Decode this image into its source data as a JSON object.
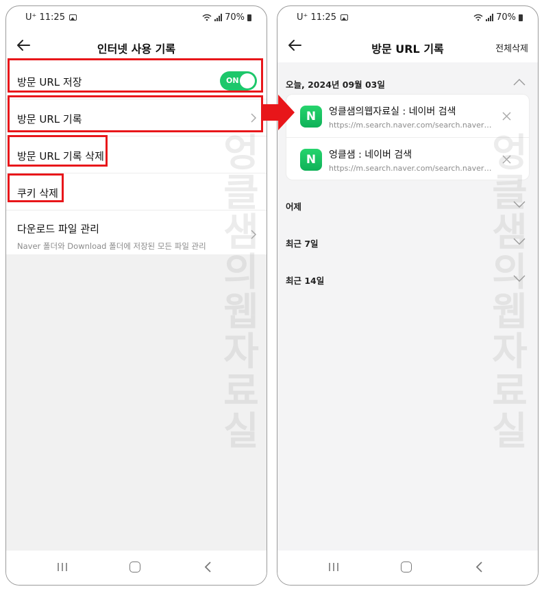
{
  "left": {
    "status": {
      "carrier": "U⁺ 11:25",
      "battery": "70%"
    },
    "title": "인터넷 사용 기록",
    "rows": [
      {
        "label": "방문 URL 저장",
        "toggle": "ON"
      },
      {
        "label": "방문 URL 기록"
      },
      {
        "label": "방문 URL 기록 삭제"
      },
      {
        "label": "쿠키 삭제"
      },
      {
        "label": "다운로드 파일 관리",
        "sub": "Naver 폴더와 Download 폴더에 저장된 모든 파일 관리"
      }
    ]
  },
  "right": {
    "status": {
      "carrier": "U⁺ 11:25",
      "battery": "70%"
    },
    "title": "방문 URL 기록",
    "action": "전체삭제",
    "today": "오늘, 2024년 09월 03일",
    "entries": [
      {
        "icon": "N",
        "title": "엉클샘의웹자료실 : 네이버 검색",
        "url": "https://m.search.naver.com/search.naver?query=..."
      },
      {
        "icon": "N",
        "title": "엉클샘 : 네이버 검색",
        "url": "https://m.search.naver.com/search.naver?sm=..."
      }
    ],
    "sections": [
      "어제",
      "최근 7일",
      "최근 14일"
    ]
  },
  "watermark": [
    "엉",
    "클",
    "샘",
    "의",
    "웹",
    "자",
    "료",
    "실"
  ],
  "colors": {
    "toggle_on": "#1dc76b",
    "highlight": "#e8161a",
    "naver_green": "#1ac45f"
  }
}
